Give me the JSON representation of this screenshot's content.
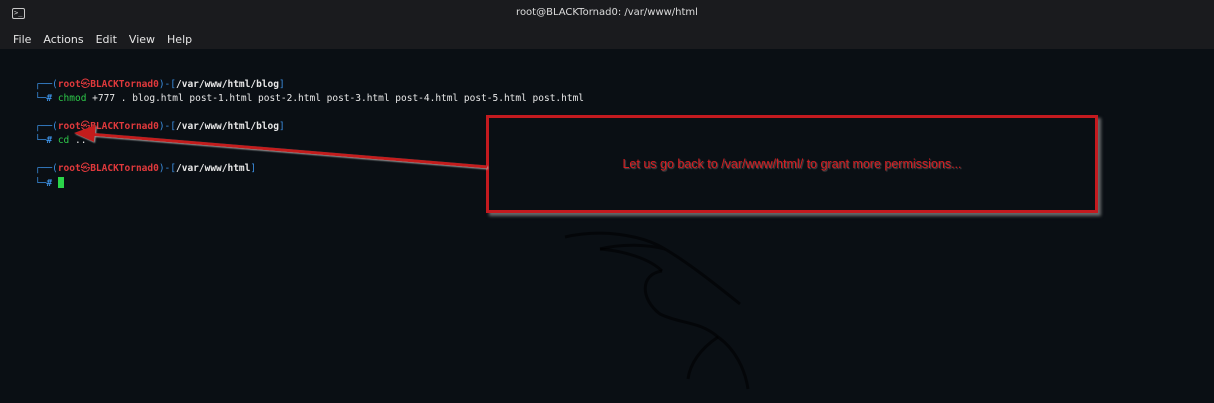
{
  "window": {
    "title": "root@BLACKTornad0: /var/www/html",
    "icon": "terminal-icon",
    "icon_glyph": ">_"
  },
  "menu": [
    "File",
    "Actions",
    "Edit",
    "View",
    "Help"
  ],
  "terminal": {
    "blocks": [
      {
        "prompt_user": "root",
        "prompt_skull": "㉿",
        "prompt_host": "BLACKTornad0",
        "prompt_path": "/var/www/html/blog",
        "prompt_hash": "#",
        "command": "chmod",
        "args": "+777 . blog.html post-1.html post-2.html post-3.html post-4.html post-5.html post.html"
      },
      {
        "prompt_user": "root",
        "prompt_skull": "㉿",
        "prompt_host": "BLACKTornad0",
        "prompt_path": "/var/www/html/blog",
        "prompt_hash": "#",
        "command": "cd",
        "args": ".."
      },
      {
        "prompt_user": "root",
        "prompt_skull": "㉿",
        "prompt_host": "BLACKTornad0",
        "prompt_path": "/var/www/html",
        "prompt_hash": "#",
        "command": "",
        "args": ""
      }
    ]
  },
  "annotation": {
    "text": "Let us go back to /var/www/html/ to grant more permissions...",
    "color": "#d61e22"
  },
  "colors": {
    "background": "#0a0f14",
    "prompt_frame": "#3b8ee0",
    "user": "#e0393c",
    "command": "#2ec94a",
    "cursor": "#2bd44a"
  }
}
